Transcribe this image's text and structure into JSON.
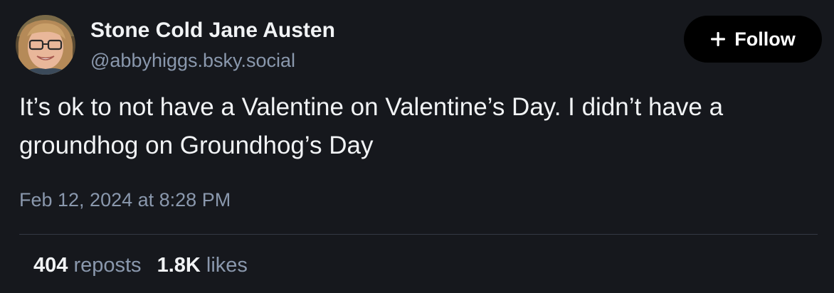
{
  "author": {
    "display_name": "Stone Cold Jane Austen",
    "handle": "@abbyhiggs.bsky.social",
    "avatar_icon": "user-avatar-photo"
  },
  "follow_button": {
    "label": "Follow",
    "icon": "plus-icon"
  },
  "post": {
    "text": "It’s ok to not have a Valentine on Valentine’s Day. I didn’t have a groundhog on Groundhog’s Day",
    "timestamp": "Feb 12, 2024 at 8:28 PM"
  },
  "stats": {
    "reposts_count": "404",
    "reposts_label": "reposts",
    "likes_count": "1.8K",
    "likes_label": "likes"
  },
  "colors": {
    "background": "#16181d",
    "primary_text": "#f1f3f5",
    "secondary_text": "#8a98ad",
    "divider": "#343944",
    "follow_button_bg": "#000000"
  }
}
